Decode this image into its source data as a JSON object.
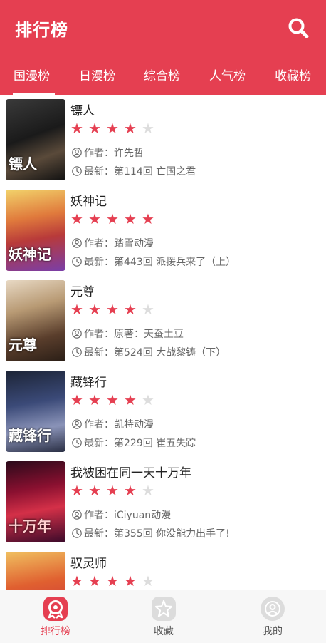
{
  "header": {
    "title": "排行榜",
    "accent": "#e53f51",
    "search_icon": "search-icon"
  },
  "tabs": [
    {
      "label": "国漫榜",
      "active": true
    },
    {
      "label": "日漫榜",
      "active": false
    },
    {
      "label": "综合榜",
      "active": false
    },
    {
      "label": "人气榜",
      "active": false
    },
    {
      "label": "收藏榜",
      "active": false
    }
  ],
  "comics": [
    {
      "title": "镖人",
      "rating": 4,
      "author_label": "作者：",
      "author": "许先哲",
      "latest_label": "最新：",
      "latest": "第114回 亡国之君",
      "cover_text": "镖人"
    },
    {
      "title": "妖神记",
      "rating": 5,
      "author_label": "作者：",
      "author": "踏雪动漫",
      "latest_label": "最新：",
      "latest": "第443回 派援兵来了（上）",
      "cover_text": "妖神记"
    },
    {
      "title": "元尊",
      "rating": 4,
      "author_label": "作者：",
      "author": "原著：天蚕土豆",
      "latest_label": "最新：",
      "latest": "第524回 大战黎铸（下）",
      "cover_text": "元尊"
    },
    {
      "title": "藏锋行",
      "rating": 4,
      "author_label": "作者：",
      "author": "凯特动漫",
      "latest_label": "最新：",
      "latest": "第229回 崔五失踪",
      "cover_text": "藏锋行"
    },
    {
      "title": "我被困在同一天十万年",
      "rating": 4,
      "author_label": "作者：",
      "author": "iCiyuan动漫",
      "latest_label": "最新：",
      "latest": "第355回 你没能力出手了!",
      "cover_text": "十万年"
    },
    {
      "title": "驭灵师",
      "rating": 4,
      "author_label": "",
      "author": "",
      "latest_label": "",
      "latest": "",
      "cover_text": ""
    }
  ],
  "bottom_nav": [
    {
      "label": "排行榜",
      "icon": "ranking-icon",
      "active": true
    },
    {
      "label": "收藏",
      "icon": "star-icon",
      "active": false
    },
    {
      "label": "我的",
      "icon": "profile-icon",
      "active": false
    }
  ],
  "colors": {
    "star_on": "#e53f51",
    "star_off": "#dddddd",
    "nav_active": "#e53f51",
    "nav_inactive": "#555555"
  }
}
